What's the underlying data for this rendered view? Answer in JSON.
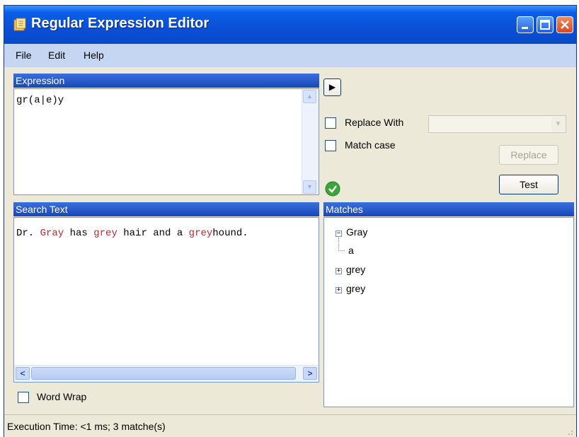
{
  "window": {
    "title": "Regular Expression Editor"
  },
  "menu": {
    "file": "File",
    "edit": "Edit",
    "help": "Help"
  },
  "expression": {
    "header": "Expression",
    "value": "gr(a|e)y"
  },
  "replace_with": {
    "label": "Replace With",
    "value": ""
  },
  "match_case": {
    "label": "Match case"
  },
  "buttons": {
    "replace": "Replace",
    "test": "Test",
    "run_glyph": "▶"
  },
  "search": {
    "header": "Search Text",
    "segments": [
      "Dr. ",
      "Gray",
      " has ",
      "grey",
      " hair and a ",
      "grey",
      "hound."
    ]
  },
  "matches": {
    "header": "Matches",
    "items": [
      {
        "label": "Gray",
        "expanded": true,
        "children": [
          "a"
        ]
      },
      {
        "label": "grey",
        "expanded": false
      },
      {
        "label": "grey",
        "expanded": false
      }
    ]
  },
  "word_wrap": {
    "label": "Word Wrap"
  },
  "status": {
    "text": "Execution Time: <1 ms; 3 matche(s)"
  },
  "icons": {
    "app": "regex-app-icon",
    "valid": "check-circle-icon"
  },
  "colors": {
    "match_highlight": "#c0282d",
    "titlebar": "#0b4fd6",
    "panel_header": "#2450c2",
    "valid_icon": "#3aa63a"
  }
}
